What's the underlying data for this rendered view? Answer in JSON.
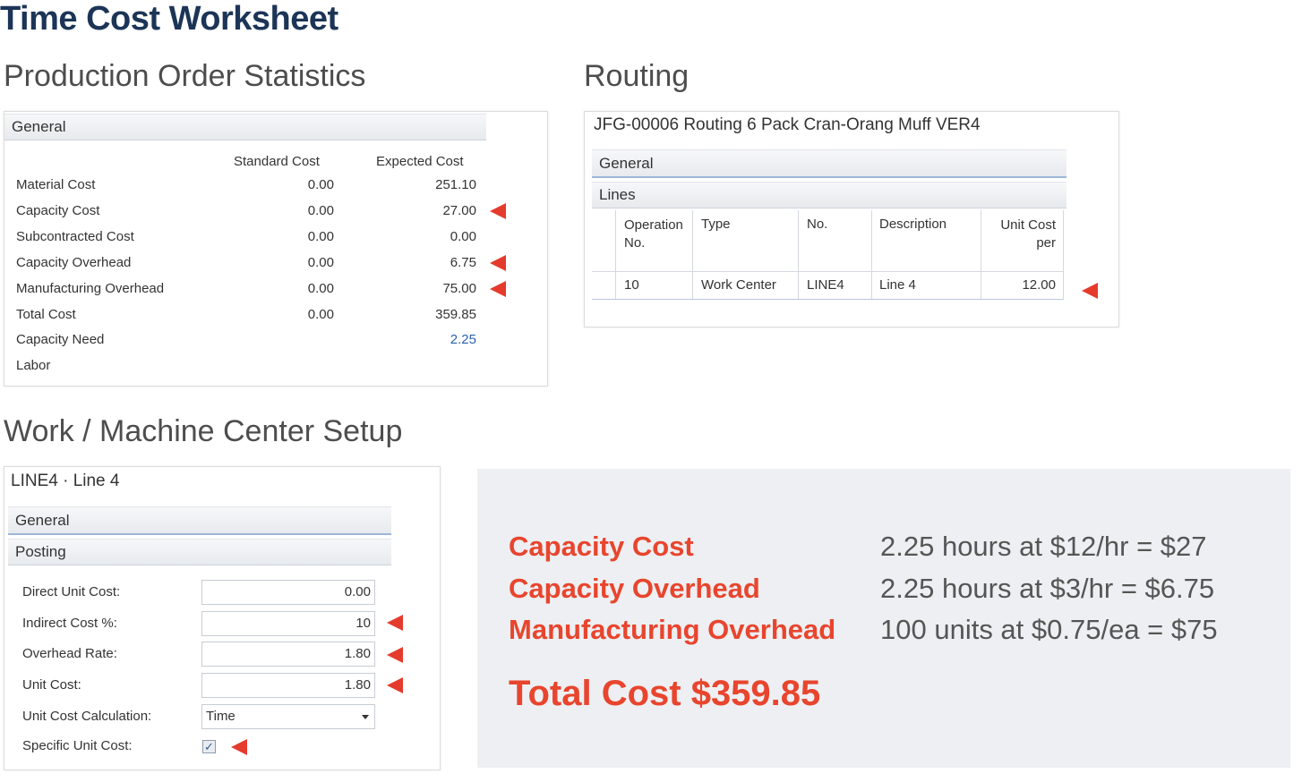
{
  "title": "Time Cost Worksheet",
  "stats": {
    "section_title": "Production Order Statistics",
    "tab": "General",
    "col_standard": "Standard Cost",
    "col_expected": "Expected Cost",
    "rows": [
      {
        "label": "Material Cost",
        "standard": "0.00",
        "expected": "251.10"
      },
      {
        "label": "Capacity Cost",
        "standard": "0.00",
        "expected": "27.00"
      },
      {
        "label": "Subcontracted Cost",
        "standard": "0.00",
        "expected": "0.00"
      },
      {
        "label": "Capacity Overhead",
        "standard": "0.00",
        "expected": "6.75"
      },
      {
        "label": "Manufacturing Overhead",
        "standard": "0.00",
        "expected": "75.00"
      },
      {
        "label": "Total Cost",
        "standard": "0.00",
        "expected": "359.85"
      },
      {
        "label": "Capacity Need",
        "standard": "",
        "expected": "2.25"
      },
      {
        "label": "Labor",
        "standard": "",
        "expected": ""
      }
    ]
  },
  "routing": {
    "section_title": "Routing",
    "header": "JFG-00006 Routing 6 Pack Cran-Orang Muff VER4",
    "tab_general": "General",
    "tab_lines": "Lines",
    "columns": {
      "operation_1": "Operation",
      "operation_2": "No.",
      "type": "Type",
      "no": "No.",
      "description": "Description",
      "unit_cost_1": "Unit Cost",
      "unit_cost_2": "per"
    },
    "row": {
      "operation": "10",
      "type": "Work Center",
      "no": "LINE4",
      "description": "Line 4",
      "unit_cost": "12.00"
    }
  },
  "work_center": {
    "section_title": "Work / Machine Center Setup",
    "header": "LINE4 · Line 4",
    "tab_general": "General",
    "tab_posting": "Posting",
    "fields": {
      "direct_unit_cost_label": "Direct Unit Cost:",
      "direct_unit_cost": "0.00",
      "indirect_cost_label": "Indirect Cost %:",
      "indirect_cost": "10",
      "overhead_rate_label": "Overhead Rate:",
      "overhead_rate": "1.80",
      "unit_cost_label": "Unit Cost:",
      "unit_cost": "1.80",
      "unit_cost_calc_label": "Unit Cost Calculation:",
      "unit_cost_calc": "Time",
      "specific_unit_cost_label": "Specific Unit Cost:",
      "specific_unit_cost_checked": true
    }
  },
  "summary": {
    "capacity_cost_label": "Capacity Cost",
    "capacity_cost_value": "2.25 hours at $12/hr = $27",
    "capacity_overhead_label": "Capacity Overhead",
    "capacity_overhead_value": "2.25 hours at $3/hr = $6.75",
    "manufacturing_overhead_label": "Manufacturing Overhead",
    "manufacturing_overhead_value": "100 units at $0.75/ea = $75",
    "total": "Total Cost $359.85"
  },
  "colors": {
    "accent": "#e8452e",
    "title": "#1c3557",
    "link": "#2a62b0"
  },
  "icons": {
    "pointer": "red-left-arrow-icon",
    "dropdown": "chevron-down-icon",
    "check": "checkmark-icon"
  }
}
